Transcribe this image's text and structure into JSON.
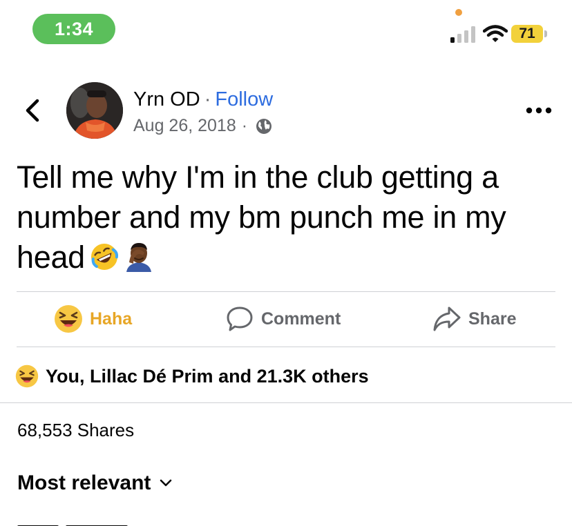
{
  "status_bar": {
    "time": "1:34",
    "battery": "71"
  },
  "post": {
    "author": "Yrn OD",
    "separator": "·",
    "follow_label": "Follow",
    "date": "Aug 26, 2018",
    "meta_separator": "·",
    "audience_icon": "globe-icon",
    "text": "Tell me why I'm in the club getting a number and my bm punch me in my head",
    "emojis": [
      "rolling-on-floor-laughing-emoji",
      "facepalm-emoji"
    ]
  },
  "actions": {
    "haha_label": "Haha",
    "comment_label": "Comment",
    "share_label": "Share",
    "haha_color": "#e7a626"
  },
  "reactions": {
    "summary": "You, Lillac Dé Prim and 21.3K others",
    "icon": "haha-reaction-icon"
  },
  "shares": {
    "count_label": "68,553 Shares"
  },
  "comments": {
    "sort_label": "Most relevant"
  },
  "colors": {
    "follow_blue": "#2d6cdf",
    "time_pill_green": "#5bbf5b",
    "battery_yellow": "#f2d13b",
    "secondary_text": "#65676b"
  }
}
